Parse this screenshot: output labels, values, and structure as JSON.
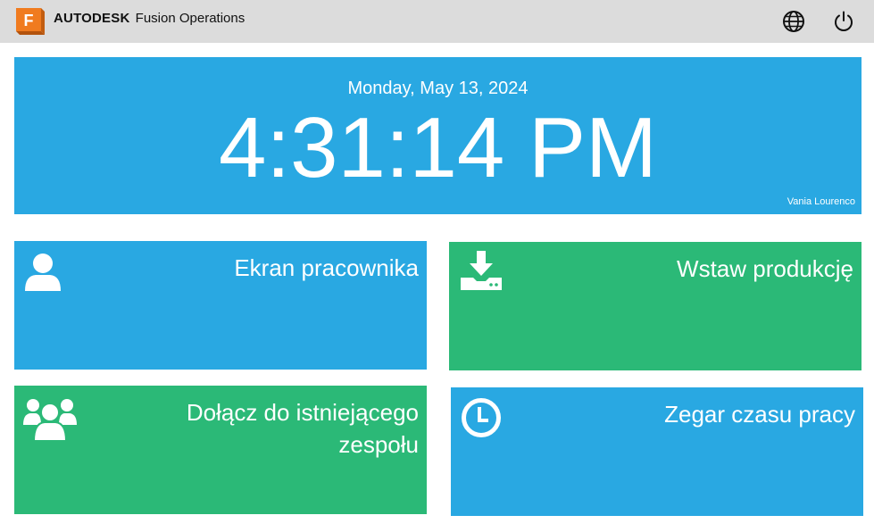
{
  "header": {
    "logo_letter": "F",
    "brand_bold": "AUTODESK",
    "brand_product": "Fusion Operations",
    "globe_icon": "globe-icon",
    "power_icon": "power-icon",
    "logo_color": "#f07b1f"
  },
  "clock": {
    "date": "Monday, May 13, 2024",
    "time": "4:31:14 PM",
    "user": "Vania Lourenco",
    "color": "#29a8e2"
  },
  "tiles": [
    {
      "label": "Ekran pracownika",
      "icon": "user-icon",
      "color": "#29a8e2"
    },
    {
      "label": "Wstaw produkcję",
      "icon": "download-tray-icon",
      "color": "#2bb977"
    },
    {
      "label": "Dołącz do istniejącego zespołu",
      "icon": "group-icon",
      "color": "#2bb977"
    },
    {
      "label": "Zegar czasu pracy",
      "icon": "clock-icon",
      "color": "#29a8e2"
    }
  ]
}
